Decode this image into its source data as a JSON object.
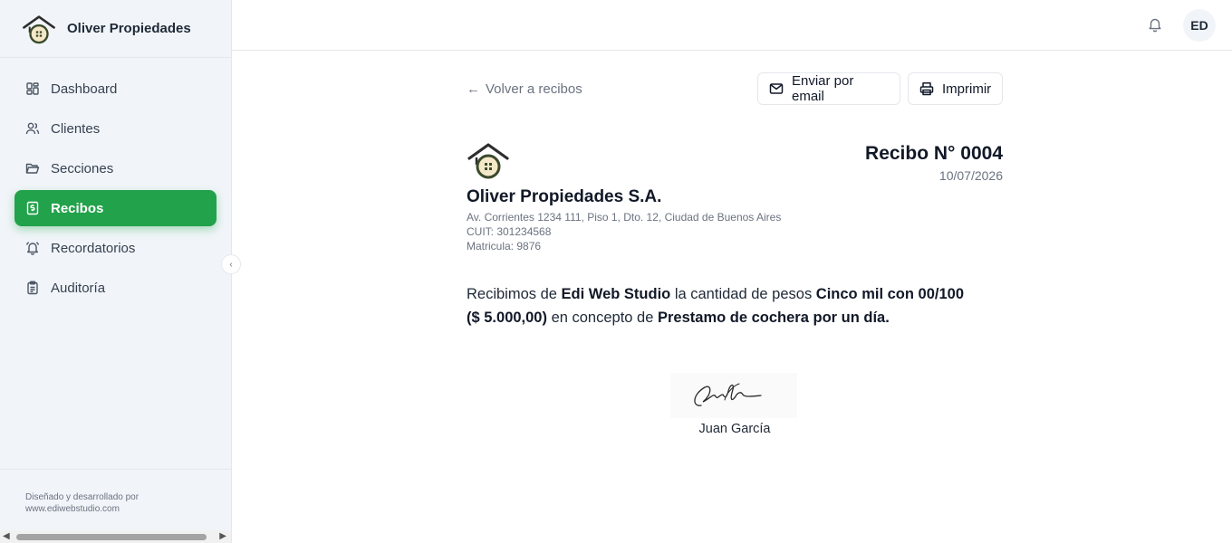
{
  "brand": {
    "name": "Oliver Propiedades",
    "logo_icon": "house-logo-icon"
  },
  "sidebar": {
    "items": [
      {
        "label": "Dashboard",
        "icon": "dashboard-icon",
        "active": false
      },
      {
        "label": "Clientes",
        "icon": "users-icon",
        "active": false
      },
      {
        "label": "Secciones",
        "icon": "folder-icon",
        "active": false
      },
      {
        "label": "Recibos",
        "icon": "receipt-icon",
        "active": true
      },
      {
        "label": "Recordatorios",
        "icon": "bell-icon",
        "active": false
      },
      {
        "label": "Auditoría",
        "icon": "clipboard-icon",
        "active": false
      }
    ],
    "footer": {
      "line1": "Diseñado y desarrollado por",
      "line2": "www.ediwebstudio.com"
    }
  },
  "header": {
    "avatar_initials": "ED"
  },
  "receipt_page": {
    "back_label": "Volver a recibos",
    "email_button": "Enviar por email",
    "print_button": "Imprimir",
    "company": {
      "name": "Oliver Propiedades S.A.",
      "address": "Av. Corrientes 1234 111, Piso 1, Dto. 12, Ciudad de Buenos Aires",
      "cuit": "CUIT: 301234568",
      "matricula": "Matricula: 9876"
    },
    "title": "Recibo N° 0004",
    "date": "10/07/2026",
    "body": {
      "part1": "Recibimos de ",
      "client": "Edi Web Studio",
      "part2": " la cantidad de pesos ",
      "amount_words": "Cinco mil con 00/100",
      "amount_number": "($ 5.000,00)",
      "part3": " en concepto de ",
      "concept": "Prestamo de cochera por un día."
    },
    "signer": "Juan García"
  },
  "colors": {
    "accent": "#22a24a",
    "sidebar_bg": "#f1f5f9",
    "muted_text": "#6b7280"
  }
}
